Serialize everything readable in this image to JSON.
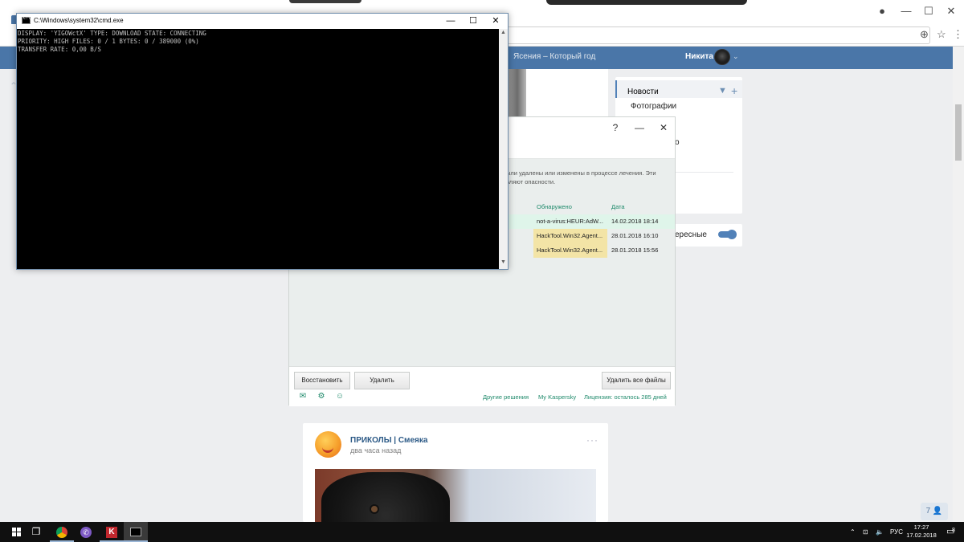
{
  "browser": {
    "window_controls": {
      "minimize": "—",
      "maximize": "☐",
      "close": "✕",
      "account": "●",
      "menu": "⋮"
    },
    "addressbar_icons": {
      "zoom": "⊕",
      "star": "☆"
    }
  },
  "vk": {
    "now_playing": "Ясения – Который год",
    "user_name": "Никита",
    "menu": {
      "active_item": "Новости",
      "items": [
        "Фотографии"
      ],
      "partial_item": "о"
    },
    "toggle_label": "ересные",
    "friends_badge": "7 👤",
    "post": {
      "title": "ПРИКОЛЫ | Смеяка",
      "time": "два часа назад",
      "more": "···"
    }
  },
  "kaspersky": {
    "help_button": "?",
    "minimize_button": "—",
    "close_button": "✕",
    "description_line1": "ыли удалены или изменены в процессе лечения. Эти",
    "description_line2": "вляют опасности.",
    "columns": {
      "detected": "Обнаружено",
      "date": "Дата"
    },
    "rows": [
      {
        "detected": "not-a-virus:HEUR:AdW...",
        "date": "14.02.2018 18:14",
        "highlight": "#dff5ea"
      },
      {
        "detected": "HackTool.Win32.Agent...",
        "date": "28.01.2018 16:10",
        "highlight": "#f3e4a6"
      },
      {
        "detected": "HackTool.Win32.Agent...",
        "date": "28.01.2018 15:56",
        "highlight": "#f3e4a6"
      }
    ],
    "buttons": {
      "restore": "Восстановить",
      "delete": "Удалить",
      "delete_all": "Удалить все файлы"
    },
    "footer_links": {
      "other_solutions": "Другие решения",
      "my_kaspersky": "My Kaspersky",
      "license": "Лицензия: осталось 285 дней"
    },
    "accent": "#1f8a6b"
  },
  "cmd": {
    "title": "C:\\Windows\\system32\\cmd.exe",
    "lines": [
      "DISPLAY: 'YIGOWctX' TYPE: DOWNLOAD STATE: CONNECTING",
      "PRIORITY: HIGH FILES: 0 / 1 BYTES: 0 / 389000 (0%)",
      "TRANSFER RATE: 0,00 B/S"
    ],
    "controls": {
      "minimize": "—",
      "maximize": "☐",
      "close": "✕"
    }
  },
  "taskbar": {
    "language": "РУС",
    "time": "17:27",
    "date": "17.02.2018",
    "notification_count": "8"
  }
}
